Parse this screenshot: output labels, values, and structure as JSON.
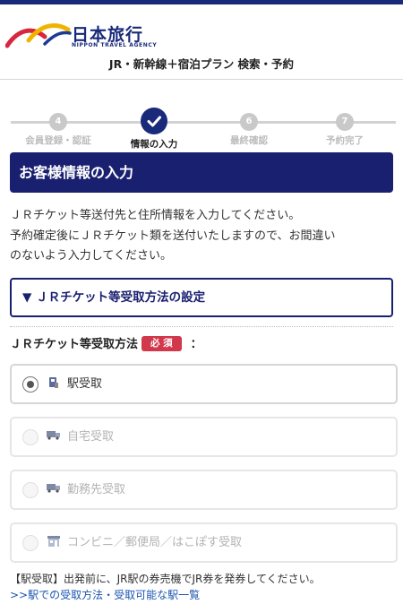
{
  "header": {
    "logo_text": "日本旅行",
    "logo_subtext": "NIPPON TRAVEL AGENCY",
    "site_title": "JR・新幹線＋宿泊プラン 検索・予約"
  },
  "steps": [
    {
      "number": "4",
      "label": "会員登録・認証",
      "state": "done"
    },
    {
      "number": "",
      "label": "情報の入力",
      "state": "active"
    },
    {
      "number": "6",
      "label": "最終確認",
      "state": "pending"
    },
    {
      "number": "7",
      "label": "予約完了",
      "state": "pending"
    }
  ],
  "section_title": "お客様情報の入力",
  "intro": {
    "line1": "ＪＲチケット等送付先と住所情報を入力してください。",
    "line2": "予約確定後にＪＲチケット類を送付いたしますので、お間違い",
    "line3": "のないよう入力してください。"
  },
  "subsection_title": "▼ ＪＲチケット等受取方法の設定",
  "field": {
    "label": "ＪＲチケット等受取方法",
    "required_badge": "必 須",
    "colon": "："
  },
  "options": [
    {
      "label": "駅受取",
      "icon": "station-ticket-icon",
      "checked": true,
      "disabled": false
    },
    {
      "label": "自宅受取",
      "icon": "delivery-truck-icon",
      "checked": false,
      "disabled": true
    },
    {
      "label": "勤務先受取",
      "icon": "delivery-truck-icon",
      "checked": false,
      "disabled": true
    },
    {
      "label": "コンビニ／郵便局／はこぽす受取",
      "icon": "store-icon",
      "checked": false,
      "disabled": true
    }
  ],
  "note": "【駅受取】出発前に、JR駅の券売機でJR券を発券してください。",
  "link": ">>駅での受取方法・受取可能な駅一覧",
  "colors": {
    "brand_navy": "#1a2070",
    "required_red": "#d1384c",
    "link_blue": "#1a55b0"
  }
}
